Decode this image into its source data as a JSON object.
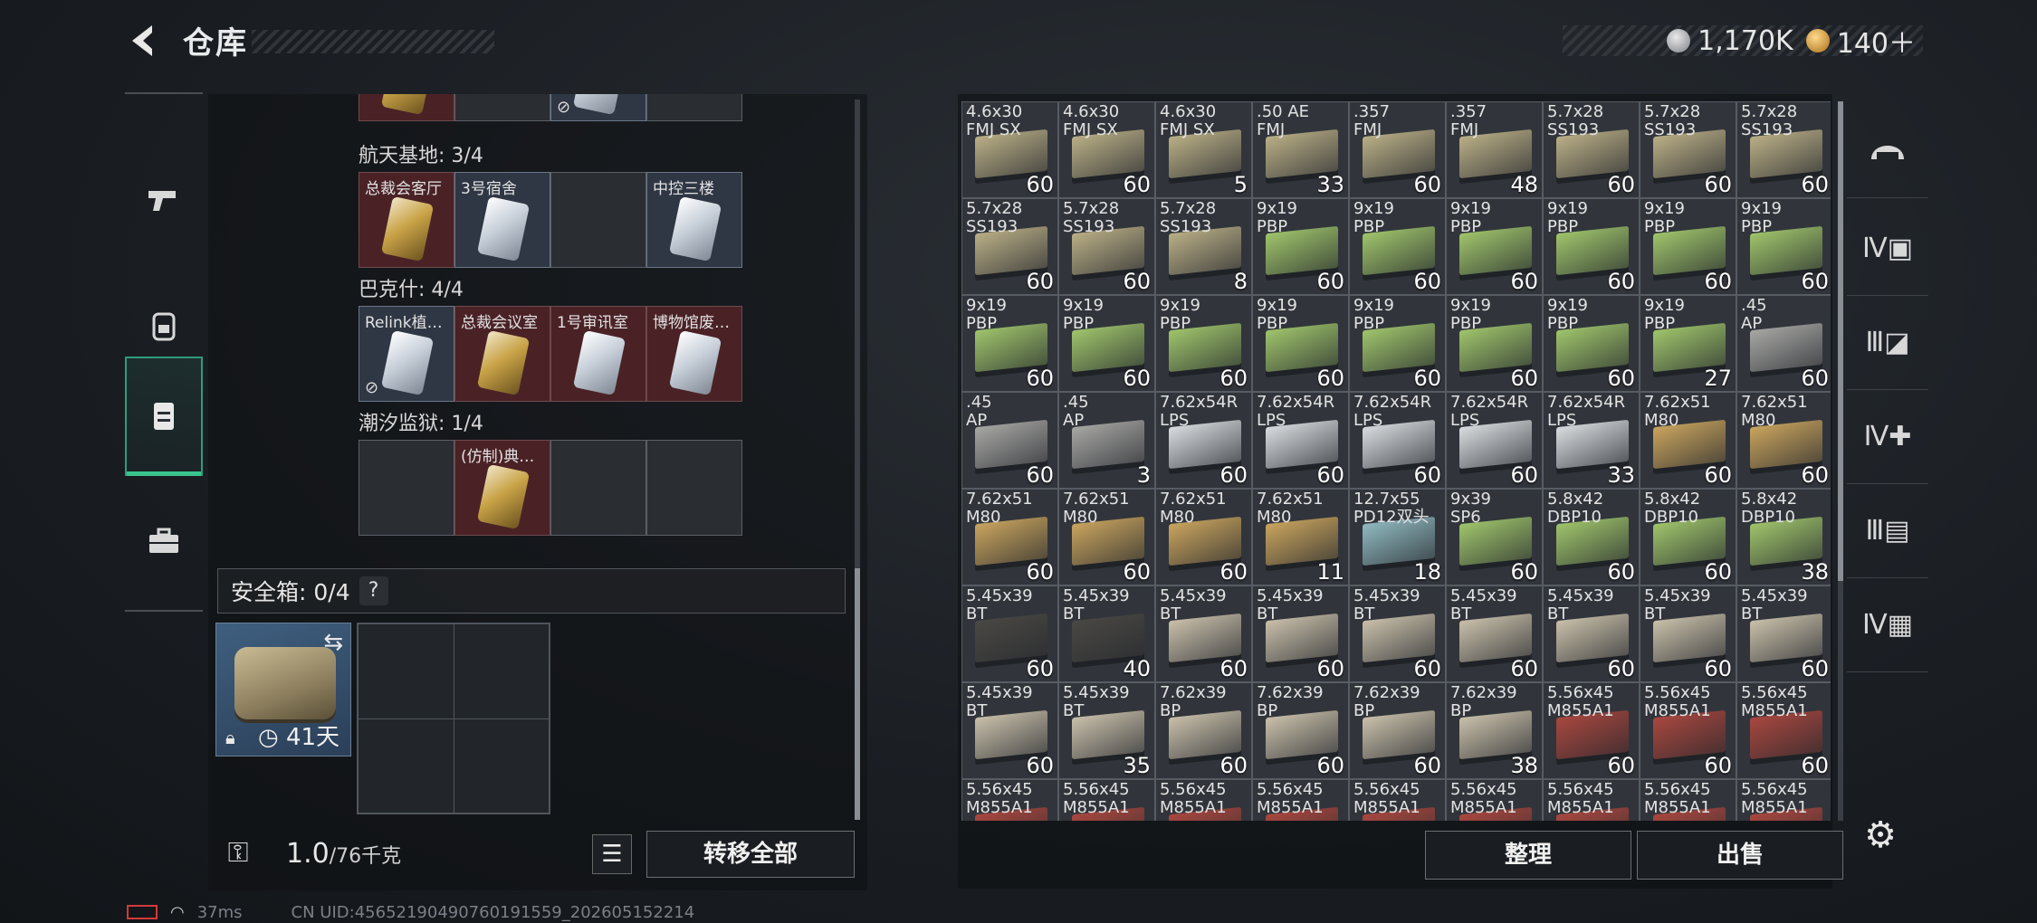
{
  "header": {
    "title": "仓库",
    "currency": [
      {
        "icon": "silver-coin-icon",
        "value": "1,170K"
      },
      {
        "icon": "gold-coin-icon",
        "value": "140＋"
      }
    ]
  },
  "left_nav": [
    {
      "icon": "pistol-icon",
      "label": "weapons"
    },
    {
      "icon": "backpack-icon",
      "label": "gear"
    },
    {
      "icon": "storage-icon",
      "label": "storage",
      "active": true
    },
    {
      "icon": "toolbox-icon",
      "label": "tools"
    }
  ],
  "key_groups": [
    {
      "label": "航天基地: 3/4",
      "slots": [
        {
          "name": "总裁会客厅",
          "color": "red",
          "card": "gold"
        },
        {
          "name": "3号宿舍",
          "color": "blue",
          "card": "silver"
        },
        {
          "name": "",
          "color": "empty",
          "card": ""
        },
        {
          "name": "中控三楼",
          "color": "blue",
          "card": "silver"
        }
      ]
    },
    {
      "label": "巴克什: 4/4",
      "slots": [
        {
          "name": "Relink植…",
          "color": "blue",
          "card": "silver",
          "locked": true
        },
        {
          "name": "总裁会议室",
          "color": "red",
          "card": "gold"
        },
        {
          "name": "1号审讯室",
          "color": "red",
          "card": "silver"
        },
        {
          "name": "博物馆废…",
          "color": "red",
          "card": "silver"
        }
      ]
    },
    {
      "label": "潮汐监狱: 1/4",
      "slots": [
        {
          "name": "",
          "color": "empty",
          "card": ""
        },
        {
          "name": "(仿制)典…",
          "color": "red",
          "card": "gold"
        },
        {
          "name": "",
          "color": "empty",
          "card": ""
        },
        {
          "name": "",
          "color": "empty",
          "card": ""
        }
      ]
    }
  ],
  "safe_box": {
    "title": "安全箱: 0/4",
    "help": "?",
    "days": "41天"
  },
  "weight": {
    "current": "1.0",
    "max": "/76千克"
  },
  "buttons": {
    "transfer_all": "转移全部",
    "sort": "整理",
    "sell": "出售"
  },
  "ammo_grid": [
    {
      "l1": "4.6x30",
      "l2": "FMJ SX",
      "count": "60",
      "box": "tan"
    },
    {
      "l1": "4.6x30",
      "l2": "FMJ SX",
      "count": "60",
      "box": "tan"
    },
    {
      "l1": "4.6x30",
      "l2": "FMJ SX",
      "count": "5",
      "box": "tan"
    },
    {
      "l1": ".50 AE",
      "l2": "FMJ",
      "count": "33",
      "box": "tan"
    },
    {
      "l1": ".357",
      "l2": "FMJ",
      "count": "60",
      "box": "tan"
    },
    {
      "l1": ".357",
      "l2": "FMJ",
      "count": "48",
      "box": "tan"
    },
    {
      "l1": "5.7x28",
      "l2": "SS193",
      "count": "60",
      "box": "tan"
    },
    {
      "l1": "5.7x28",
      "l2": "SS193",
      "count": "60",
      "box": "tan"
    },
    {
      "l1": "5.7x28",
      "l2": "SS193",
      "count": "60",
      "box": "tan"
    },
    {
      "l1": "5.7x28",
      "l2": "SS193",
      "count": "60",
      "box": "tan"
    },
    {
      "l1": "5.7x28",
      "l2": "SS193",
      "count": "60",
      "box": "tan"
    },
    {
      "l1": "5.7x28",
      "l2": "SS193",
      "count": "8",
      "box": "tan"
    },
    {
      "l1": "9x19",
      "l2": "PBP",
      "count": "60",
      "box": "green"
    },
    {
      "l1": "9x19",
      "l2": "PBP",
      "count": "60",
      "box": "green"
    },
    {
      "l1": "9x19",
      "l2": "PBP",
      "count": "60",
      "box": "green"
    },
    {
      "l1": "9x19",
      "l2": "PBP",
      "count": "60",
      "box": "green"
    },
    {
      "l1": "9x19",
      "l2": "PBP",
      "count": "60",
      "box": "green"
    },
    {
      "l1": "9x19",
      "l2": "PBP",
      "count": "60",
      "box": "green"
    },
    {
      "l1": "9x19",
      "l2": "PBP",
      "count": "60",
      "box": "green"
    },
    {
      "l1": "9x19",
      "l2": "PBP",
      "count": "60",
      "box": "green"
    },
    {
      "l1": "9x19",
      "l2": "PBP",
      "count": "60",
      "box": "green"
    },
    {
      "l1": "9x19",
      "l2": "PBP",
      "count": "60",
      "box": "green"
    },
    {
      "l1": "9x19",
      "l2": "PBP",
      "count": "60",
      "box": "green"
    },
    {
      "l1": "9x19",
      "l2": "PBP",
      "count": "60",
      "box": "green"
    },
    {
      "l1": "9x19",
      "l2": "PBP",
      "count": "60",
      "box": "green"
    },
    {
      "l1": "9x19",
      "l2": "PBP",
      "count": "27",
      "box": "green"
    },
    {
      "l1": ".45",
      "l2": "AP",
      "count": "60",
      "box": "grey"
    },
    {
      "l1": ".45",
      "l2": "AP",
      "count": "60",
      "box": "grey"
    },
    {
      "l1": ".45",
      "l2": "AP",
      "count": "3",
      "box": "grey"
    },
    {
      "l1": "7.62x54R",
      "l2": "LPS",
      "count": "60",
      "box": "white"
    },
    {
      "l1": "7.62x54R",
      "l2": "LPS",
      "count": "60",
      "box": "white"
    },
    {
      "l1": "7.62x54R",
      "l2": "LPS",
      "count": "60",
      "box": "white"
    },
    {
      "l1": "7.62x54R",
      "l2": "LPS",
      "count": "60",
      "box": "white"
    },
    {
      "l1": "7.62x54R",
      "l2": "LPS",
      "count": "33",
      "box": "white"
    },
    {
      "l1": "7.62x51",
      "l2": "M80",
      "count": "60",
      "box": "gold"
    },
    {
      "l1": "7.62x51",
      "l2": "M80",
      "count": "60",
      "box": "gold"
    },
    {
      "l1": "7.62x51",
      "l2": "M80",
      "count": "60",
      "box": "gold"
    },
    {
      "l1": "7.62x51",
      "l2": "M80",
      "count": "60",
      "box": "gold"
    },
    {
      "l1": "7.62x51",
      "l2": "M80",
      "count": "60",
      "box": "gold"
    },
    {
      "l1": "7.62x51",
      "l2": "M80",
      "count": "11",
      "box": "gold"
    },
    {
      "l1": "12.7x55",
      "l2": "PD12双头",
      "count": "18",
      "box": "teal"
    },
    {
      "l1": "9x39",
      "l2": "SP6",
      "count": "60",
      "box": "green"
    },
    {
      "l1": "5.8x42",
      "l2": "DBP10",
      "count": "60",
      "box": "green"
    },
    {
      "l1": "5.8x42",
      "l2": "DBP10",
      "count": "60",
      "box": "green"
    },
    {
      "l1": "5.8x42",
      "l2": "DBP10",
      "count": "38",
      "box": "green"
    },
    {
      "l1": "5.45x39",
      "l2": "BT",
      "count": "60",
      "box": "dark"
    },
    {
      "l1": "5.45x39",
      "l2": "BT",
      "count": "40",
      "box": "dark"
    },
    {
      "l1": "5.45x39",
      "l2": "BT",
      "count": "60",
      "box": "tan2"
    },
    {
      "l1": "5.45x39",
      "l2": "BT",
      "count": "60",
      "box": "tan2"
    },
    {
      "l1": "5.45x39",
      "l2": "BT",
      "count": "60",
      "box": "tan2"
    },
    {
      "l1": "5.45x39",
      "l2": "BT",
      "count": "60",
      "box": "tan2"
    },
    {
      "l1": "5.45x39",
      "l2": "BT",
      "count": "60",
      "box": "tan2"
    },
    {
      "l1": "5.45x39",
      "l2": "BT",
      "count": "60",
      "box": "tan2"
    },
    {
      "l1": "5.45x39",
      "l2": "BT",
      "count": "60",
      "box": "tan2"
    },
    {
      "l1": "5.45x39",
      "l2": "BT",
      "count": "60",
      "box": "tan2"
    },
    {
      "l1": "5.45x39",
      "l2": "BT",
      "count": "35",
      "box": "tan2"
    },
    {
      "l1": "7.62x39",
      "l2": "BP",
      "count": "60",
      "box": "tan2"
    },
    {
      "l1": "7.62x39",
      "l2": "BP",
      "count": "60",
      "box": "tan2"
    },
    {
      "l1": "7.62x39",
      "l2": "BP",
      "count": "60",
      "box": "tan2"
    },
    {
      "l1": "7.62x39",
      "l2": "BP",
      "count": "38",
      "box": "tan2"
    },
    {
      "l1": "5.56x45",
      "l2": "M855A1",
      "count": "60",
      "box": "red"
    },
    {
      "l1": "5.56x45",
      "l2": "M855A1",
      "count": "60",
      "box": "red"
    },
    {
      "l1": "5.56x45",
      "l2": "M855A1",
      "count": "60",
      "box": "red"
    },
    {
      "l1": "5.56x45",
      "l2": "M855A1",
      "count": "",
      "box": "red"
    },
    {
      "l1": "5.56x45",
      "l2": "M855A1",
      "count": "",
      "box": "red"
    },
    {
      "l1": "5.56x45",
      "l2": "M855A1",
      "count": "",
      "box": "red"
    },
    {
      "l1": "5.56x45",
      "l2": "M855A1",
      "count": "",
      "box": "red"
    },
    {
      "l1": "5.56x45",
      "l2": "M855A1",
      "count": "",
      "box": "red"
    },
    {
      "l1": "5.56x45",
      "l2": "M855A1",
      "count": "",
      "box": "red"
    },
    {
      "l1": "5.56x45",
      "l2": "M855A1",
      "count": "",
      "box": "red"
    },
    {
      "l1": "5.56x45",
      "l2": "M855A1",
      "count": "",
      "box": "red"
    },
    {
      "l1": "5.56x45",
      "l2": "M855A1",
      "count": "",
      "box": "red"
    }
  ],
  "box_colors": {
    "tan": "#b9ae86",
    "green": "#9fc46b",
    "grey": "#a7a7a4",
    "white": "#d9dcdf",
    "gold": "#c9a45e",
    "teal": "#8fb9bf",
    "dark": "#4a4844",
    "tan2": "#c9bfaa",
    "red": "#a8473f"
  },
  "right_rail": [
    {
      "icon": "helmet-icon",
      "label": ""
    },
    {
      "icon": "armor-iv-icon",
      "label": "IV"
    },
    {
      "icon": "armor-iii-icon",
      "label": "III"
    },
    {
      "icon": "medkit-iv-icon",
      "label": "IV"
    },
    {
      "icon": "rig-iii-icon",
      "label": "III"
    },
    {
      "icon": "bag-iv-icon",
      "label": "IV"
    }
  ],
  "status": {
    "ping": "37ms",
    "uid": "CN UID:45652190490760191559_202605152214"
  }
}
